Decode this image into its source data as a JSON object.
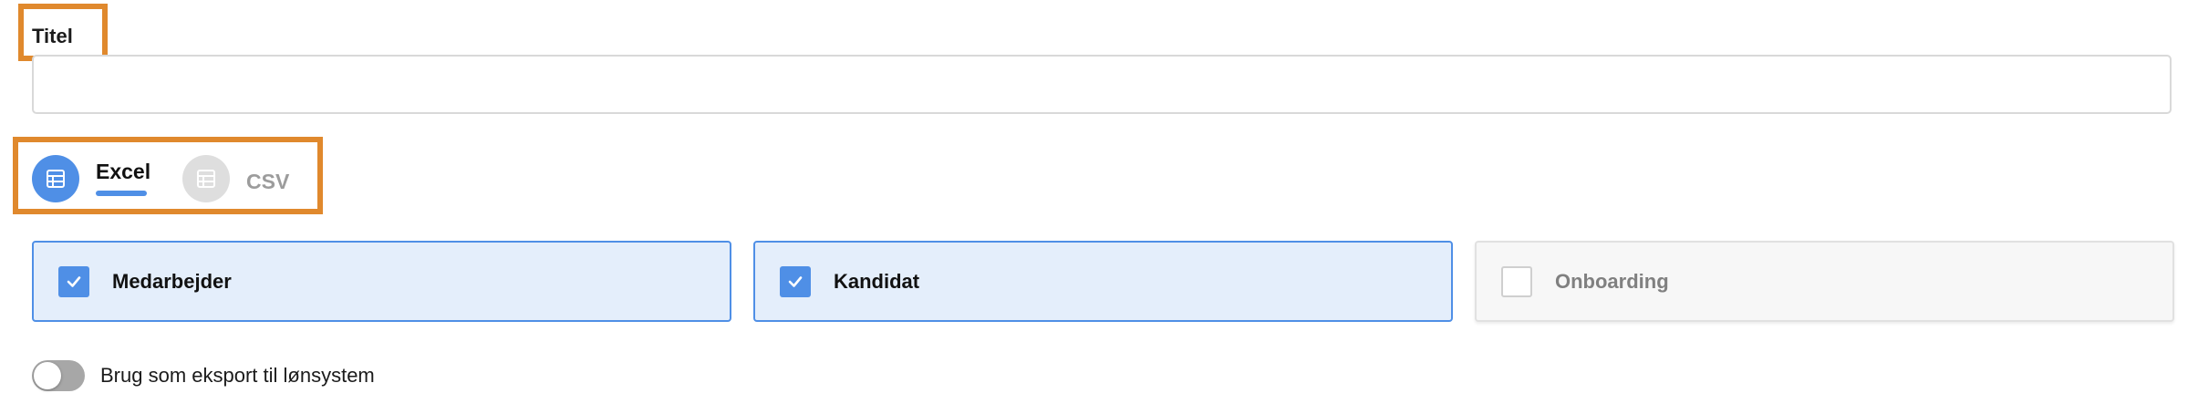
{
  "title_field": {
    "label": "Titel",
    "value": "",
    "placeholder": ""
  },
  "format": {
    "options": [
      {
        "label": "Excel",
        "icon": "spreadsheet-icon",
        "selected": true
      },
      {
        "label": "CSV",
        "icon": "spreadsheet-icon",
        "selected": false
      }
    ]
  },
  "types": [
    {
      "label": "Medarbejder",
      "checked": true
    },
    {
      "label": "Kandidat",
      "checked": true
    },
    {
      "label": "Onboarding",
      "checked": false
    }
  ],
  "payroll_toggle": {
    "label": "Brug som eksport til lønsystem",
    "on": false
  },
  "colors": {
    "accent": "#4f8fe6",
    "highlight": "#e0892d",
    "checked_card_bg": "#e4eefb"
  }
}
